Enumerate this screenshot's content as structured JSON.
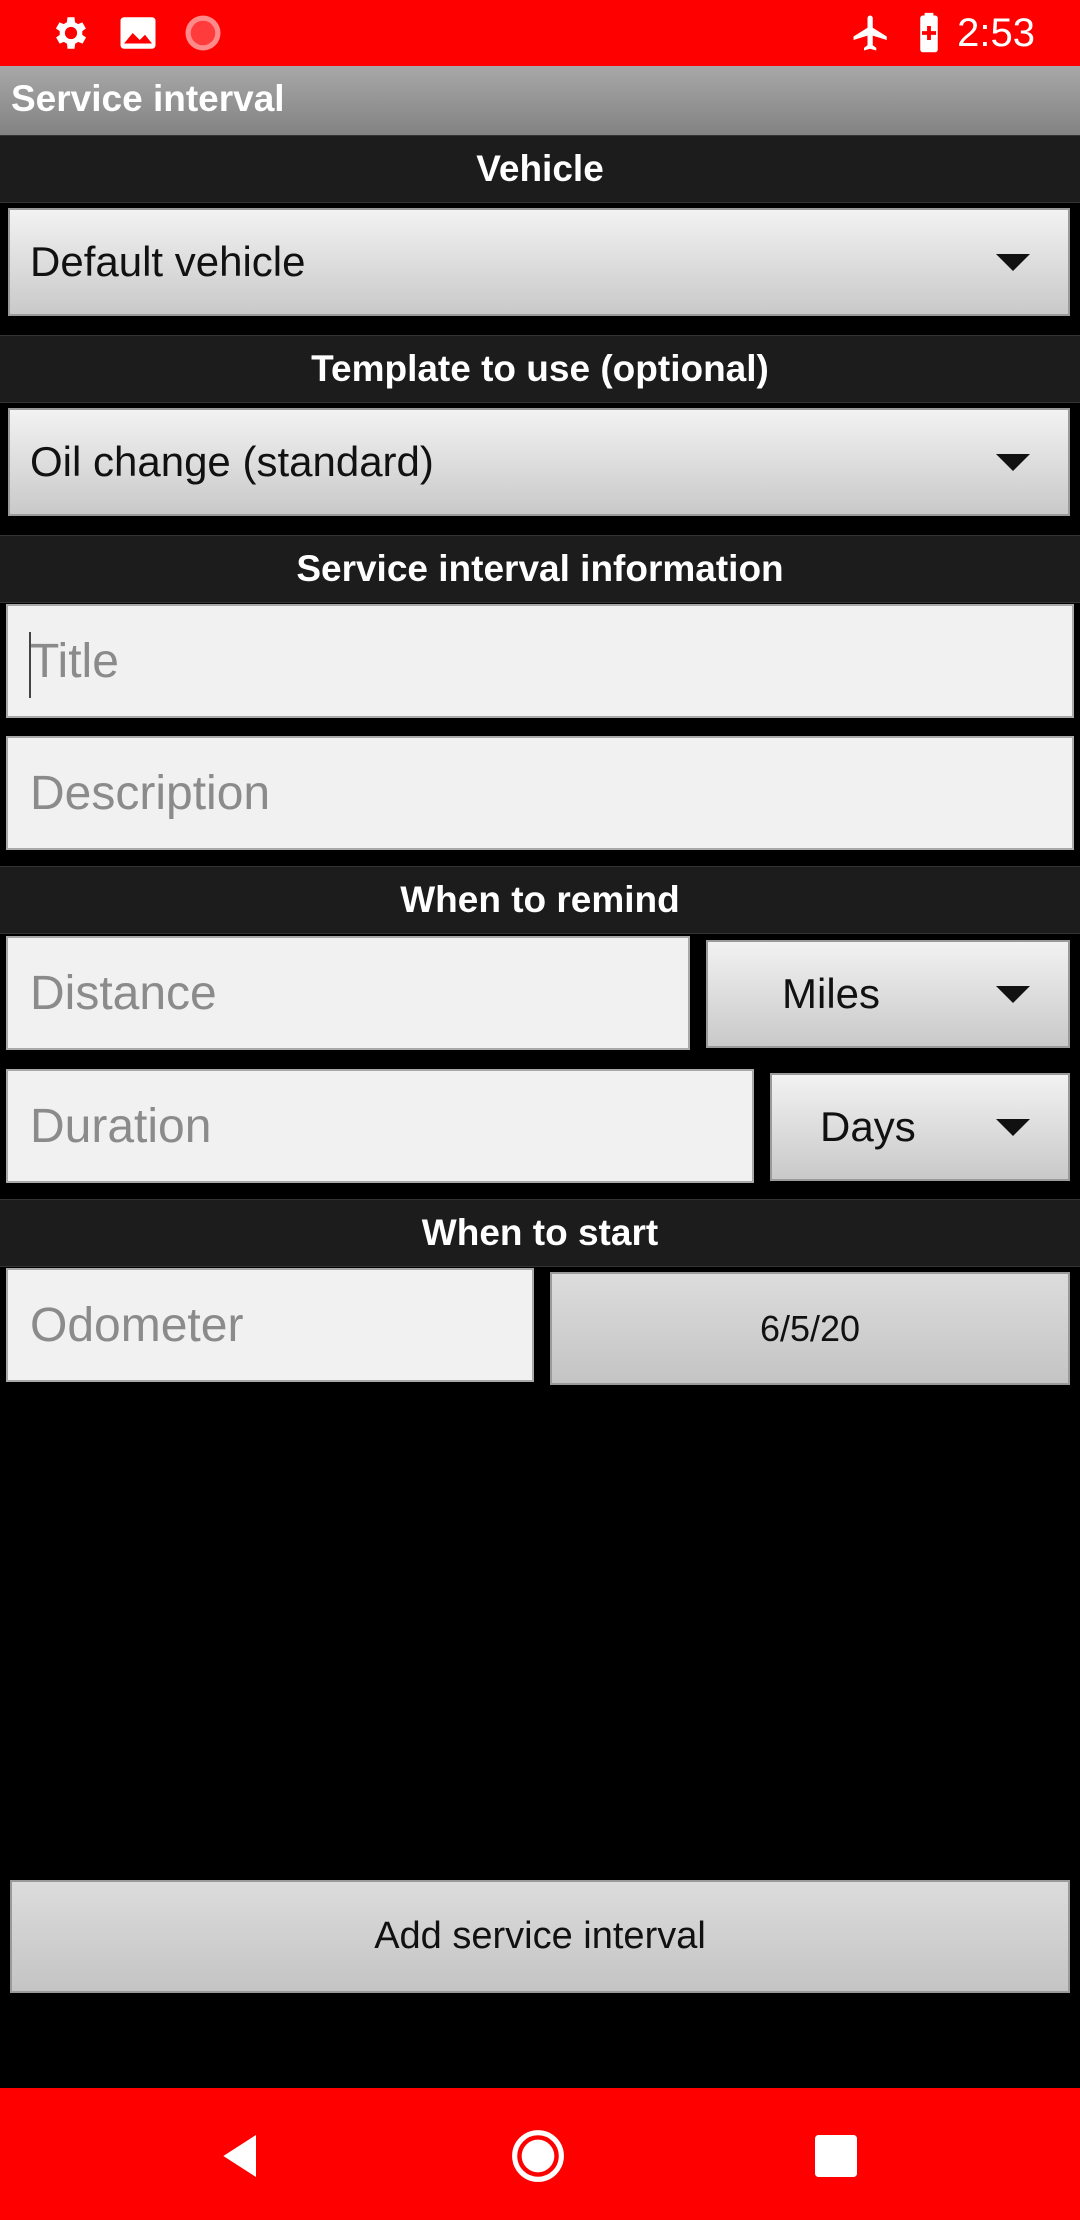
{
  "status_bar": {
    "time": "2:53",
    "left_icons": [
      "settings-icon",
      "image-icon",
      "recording-icon"
    ],
    "right_icons": [
      "airplane-mode-icon",
      "battery-icon"
    ],
    "color": "#ff0000"
  },
  "app_bar": {
    "title": "Service interval"
  },
  "sections": {
    "vehicle": "Vehicle",
    "template": "Template to use (optional)",
    "info": "Service interval information",
    "remind": "When to remind",
    "start": "When to start"
  },
  "vehicle_select": {
    "value": "Default vehicle"
  },
  "template_select": {
    "value": "Oil change (standard)"
  },
  "title_field": {
    "placeholder": "Title",
    "value": ""
  },
  "description_field": {
    "placeholder": "Description",
    "value": ""
  },
  "distance_field": {
    "placeholder": "Distance",
    "value": ""
  },
  "distance_unit_select": {
    "value": "Miles"
  },
  "duration_field": {
    "placeholder": "Duration",
    "value": ""
  },
  "duration_unit_select": {
    "value": "Days"
  },
  "odometer_field": {
    "placeholder": "Odometer",
    "value": ""
  },
  "start_date_button": {
    "label": "6/5/20"
  },
  "add_button": {
    "label": "Add service interval"
  },
  "nav_bar": {
    "icons": [
      "back-icon",
      "home-icon",
      "recents-icon"
    ]
  }
}
